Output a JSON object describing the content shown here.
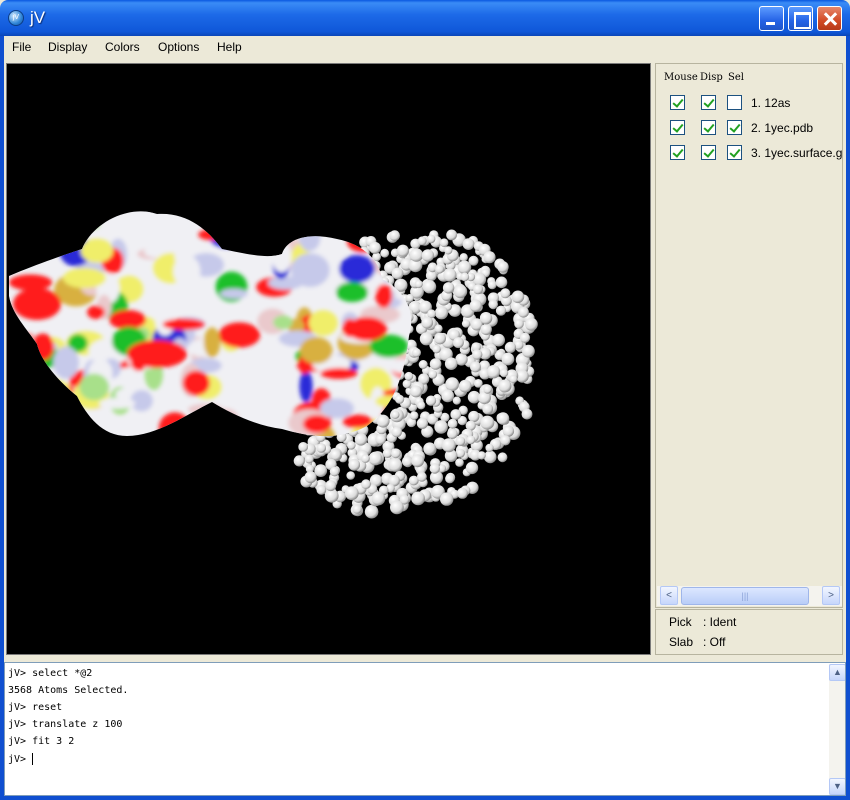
{
  "window": {
    "title": "jV",
    "icon_text": "jV"
  },
  "menu": [
    "File",
    "Display",
    "Colors",
    "Options",
    "Help"
  ],
  "panel": {
    "headers": [
      "Mouse",
      "Disp",
      "Sel"
    ],
    "models": [
      {
        "label": "1. 12as",
        "mouse": true,
        "disp": true,
        "sel": false
      },
      {
        "label": "2. 1yec.pdb",
        "mouse": true,
        "disp": true,
        "sel": true
      },
      {
        "label": "3. 1yec.surface.g",
        "mouse": true,
        "disp": true,
        "sel": true
      }
    ],
    "scroll_left": "<",
    "scroll_right": ">",
    "scroll_grip": "|||"
  },
  "status": {
    "pick_key": "Pick",
    "pick_value": ": Ident",
    "slab_key": "Slab",
    "slab_value": ": Off"
  },
  "console": {
    "lines": [
      "jV> select *@2",
      "3568 Atoms Selected.",
      "jV> reset",
      "jV> translate z 100",
      "jV> fit 3 2"
    ],
    "prompt": "jV> "
  },
  "scene": {
    "background": "#000000",
    "surface_colors": [
      "#ff1a1a",
      "#f0f0f4",
      "#eac9cc",
      "#c6c9ea",
      "#f0ee6a",
      "#a8e08a",
      "#2a2ad8",
      "#1fbf2c",
      "#d8b040"
    ],
    "sphere_color": "#f2f2f2"
  }
}
